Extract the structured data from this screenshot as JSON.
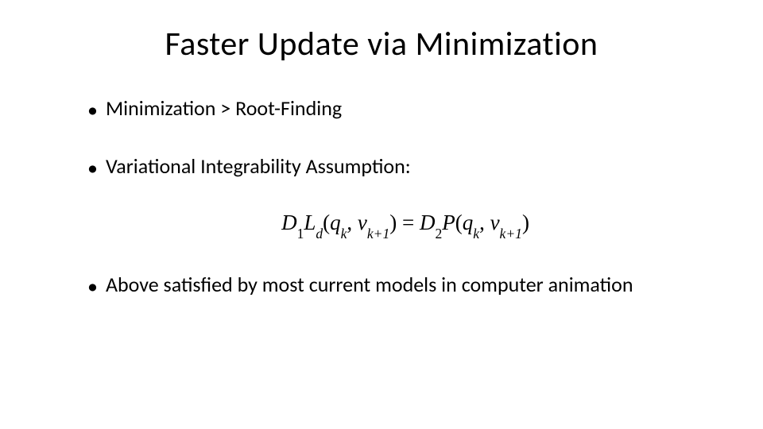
{
  "title": "Faster Update via Minimization",
  "bullets": {
    "b1": "Minimization > Root-Finding",
    "b2": "Variational Integrability Assumption:",
    "b3": "Above satisfied by most current models in computer animation"
  },
  "equation": {
    "D": "D",
    "one": "1",
    "L": "L",
    "d": "d",
    "open": "(",
    "q": "q",
    "k": "k",
    "comma": ", ",
    "v": "v",
    "kp1": "k+1",
    "close": ")",
    "eq": " = ",
    "two": "2",
    "P": "P"
  }
}
